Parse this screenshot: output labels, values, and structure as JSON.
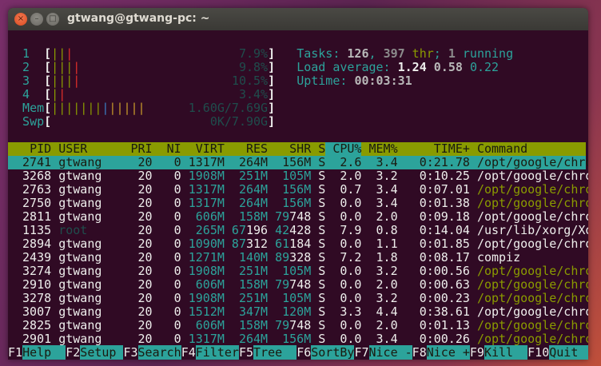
{
  "window": {
    "title": "gtwang@gtwang-pc: ~",
    "close_icon": "×",
    "min_icon": "–",
    "max_icon": "□"
  },
  "meters": {
    "cpus": [
      {
        "label": "1",
        "normal": 2,
        "kernel": 1,
        "value": "7.9%"
      },
      {
        "label": "2",
        "normal": 3,
        "kernel": 1,
        "value": "9.8%"
      },
      {
        "label": "3",
        "normal": 3,
        "kernel": 1,
        "value": "10.5%"
      },
      {
        "label": "4",
        "normal": 1,
        "kernel": 1,
        "value": "3.4%"
      }
    ],
    "mem": {
      "label": "Mem",
      "used": 7,
      "buffers": 1,
      "cache": 5,
      "value": "1.60G/7.69G"
    },
    "swp": {
      "label": "Swp",
      "value": "0K/7.90G"
    }
  },
  "summary": {
    "tasks_label": "Tasks: ",
    "tasks": "126",
    "sep1": ", ",
    "threads": "397",
    "thr_label": " thr",
    "sep2": "; ",
    "running": "1",
    "running_label": " running",
    "load_label": "Load average: ",
    "load1": "1.24",
    "load5": "0.58",
    "load15": "0.22",
    "uptime_label": "Uptime: ",
    "uptime": "00:03:31"
  },
  "columns": [
    "PID",
    "USER",
    "PRI",
    "NI",
    "VIRT",
    "RES",
    "SHR",
    "S",
    "CPU%",
    "MEM%",
    "TIME+",
    "Command"
  ],
  "sort_column": "CPU%",
  "processes": [
    {
      "pid": "2741",
      "user": "gtwang",
      "pri": "20",
      "ni": "0",
      "virt": "1317M",
      "res": "264M",
      "shr": "156M",
      "s": "S",
      "cpu": "2.6",
      "mem": "3.4",
      "time": "0:21.78",
      "cmd": "/opt/google/chrom",
      "thread": false,
      "selected": true
    },
    {
      "pid": "3268",
      "user": "gtwang",
      "pri": "20",
      "ni": "0",
      "virt": "1908M",
      "res": "251M",
      "shr": "105M",
      "s": "S",
      "cpu": "2.0",
      "mem": "3.2",
      "time": "0:10.25",
      "cmd": "/opt/google/chrom",
      "thread": false
    },
    {
      "pid": "2763",
      "user": "gtwang",
      "pri": "20",
      "ni": "0",
      "virt": "1317M",
      "res": "264M",
      "shr": "156M",
      "s": "S",
      "cpu": "0.7",
      "mem": "3.4",
      "time": "0:07.01",
      "cmd": "/opt/google/chrom",
      "thread": true
    },
    {
      "pid": "2750",
      "user": "gtwang",
      "pri": "20",
      "ni": "0",
      "virt": "1317M",
      "res": "264M",
      "shr": "156M",
      "s": "S",
      "cpu": "0.0",
      "mem": "3.4",
      "time": "0:01.38",
      "cmd": "/opt/google/chrom",
      "thread": true
    },
    {
      "pid": "2811",
      "user": "gtwang",
      "pri": "20",
      "ni": "0",
      "virt": "606M",
      "res": "158M",
      "shr": "79748",
      "s": "S",
      "cpu": "0.0",
      "mem": "2.0",
      "time": "0:09.18",
      "cmd": "/opt/google/chrom",
      "thread": false
    },
    {
      "pid": "1135",
      "user": "root",
      "pri": "20",
      "ni": "0",
      "virt": "265M",
      "res": "67196",
      "shr": "42428",
      "s": "S",
      "cpu": "7.9",
      "mem": "0.8",
      "time": "0:14.04",
      "cmd": "/usr/lib/xorg/Xor",
      "thread": false
    },
    {
      "pid": "2894",
      "user": "gtwang",
      "pri": "20",
      "ni": "0",
      "virt": "1090M",
      "res": "87312",
      "shr": "61184",
      "s": "S",
      "cpu": "0.0",
      "mem": "1.1",
      "time": "0:01.85",
      "cmd": "/opt/google/chrom",
      "thread": false
    },
    {
      "pid": "2439",
      "user": "gtwang",
      "pri": "20",
      "ni": "0",
      "virt": "1271M",
      "res": "140M",
      "shr": "89328",
      "s": "S",
      "cpu": "7.2",
      "mem": "1.8",
      "time": "0:08.17",
      "cmd": "compiz",
      "thread": false
    },
    {
      "pid": "3274",
      "user": "gtwang",
      "pri": "20",
      "ni": "0",
      "virt": "1908M",
      "res": "251M",
      "shr": "105M",
      "s": "S",
      "cpu": "0.0",
      "mem": "3.2",
      "time": "0:00.56",
      "cmd": "/opt/google/chrom",
      "thread": true
    },
    {
      "pid": "2910",
      "user": "gtwang",
      "pri": "20",
      "ni": "0",
      "virt": "606M",
      "res": "158M",
      "shr": "79748",
      "s": "S",
      "cpu": "0.0",
      "mem": "2.0",
      "time": "0:00.63",
      "cmd": "/opt/google/chrom",
      "thread": true
    },
    {
      "pid": "3278",
      "user": "gtwang",
      "pri": "20",
      "ni": "0",
      "virt": "1908M",
      "res": "251M",
      "shr": "105M",
      "s": "S",
      "cpu": "0.0",
      "mem": "3.2",
      "time": "0:00.23",
      "cmd": "/opt/google/chrom",
      "thread": true
    },
    {
      "pid": "3007",
      "user": "gtwang",
      "pri": "20",
      "ni": "0",
      "virt": "1512M",
      "res": "347M",
      "shr": "120M",
      "s": "S",
      "cpu": "3.3",
      "mem": "4.4",
      "time": "0:38.61",
      "cmd": "/opt/google/chrom",
      "thread": false
    },
    {
      "pid": "2825",
      "user": "gtwang",
      "pri": "20",
      "ni": "0",
      "virt": "606M",
      "res": "158M",
      "shr": "79748",
      "s": "S",
      "cpu": "0.0",
      "mem": "2.0",
      "time": "0:01.13",
      "cmd": "/opt/google/chrom",
      "thread": true
    },
    {
      "pid": "2901",
      "user": "gtwang",
      "pri": "20",
      "ni": "0",
      "virt": "1317M",
      "res": "264M",
      "shr": "156M",
      "s": "S",
      "cpu": "0.0",
      "mem": "3.4",
      "time": "0:00.26",
      "cmd": "/opt/google/chrom",
      "thread": true
    }
  ],
  "function_bar": [
    {
      "key": "F1",
      "label": "Help  "
    },
    {
      "key": "F2",
      "label": "Setup "
    },
    {
      "key": "F3",
      "label": "Search"
    },
    {
      "key": "F4",
      "label": "Filter"
    },
    {
      "key": "F5",
      "label": "Tree  "
    },
    {
      "key": "F6",
      "label": "SortBy"
    },
    {
      "key": "F7",
      "label": "Nice -"
    },
    {
      "key": "F8",
      "label": "Nice +"
    },
    {
      "key": "F9",
      "label": "Kill  "
    },
    {
      "key": "F10",
      "label": "Quit  "
    }
  ],
  "colors": {
    "background": "#300a24",
    "accent": "#2ca39b",
    "header": "#899b00"
  }
}
